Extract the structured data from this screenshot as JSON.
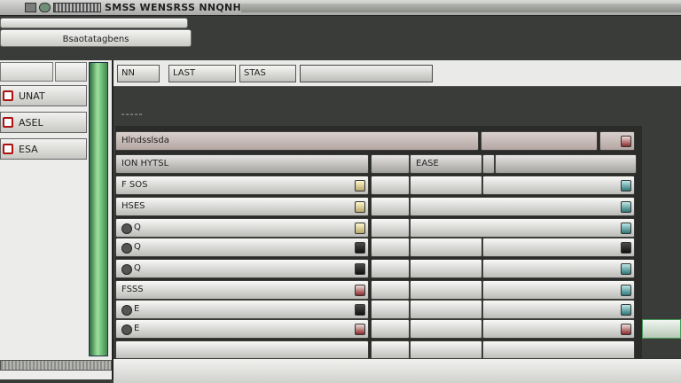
{
  "window": {
    "title": "SMSS WENSRSS NNQNHES"
  },
  "top": {
    "tab_label": "Bsaotatagbens"
  },
  "left_panel": {
    "items": [
      {
        "label": "UNAT"
      },
      {
        "label": "ASEL"
      },
      {
        "label": "ESA"
      }
    ]
  },
  "toolbar": {
    "buttons": [
      {
        "label": "NN"
      },
      {
        "label": "LAST"
      },
      {
        "label": "STAS"
      }
    ]
  },
  "grid": {
    "title": "Hlndsslsda",
    "header": {
      "col1": "ION HYTSL",
      "col3": "EASE"
    },
    "rows": [
      {
        "label": "F SOS",
        "mini": "yel",
        "right": "teal",
        "c3_label": ""
      },
      {
        "label": "HSES",
        "mini": "yel",
        "right": "teal"
      },
      {
        "label": "Q",
        "mini": "yel",
        "right": "teal"
      },
      {
        "label": "Q",
        "mini": "dark",
        "right": "dark"
      },
      {
        "label": "Q",
        "mini": "dark",
        "right": "teal"
      },
      {
        "label": "FSSS",
        "mini": "red",
        "right": "teal"
      },
      {
        "label": "E",
        "mini": "dark",
        "right": "teal"
      },
      {
        "label": "E",
        "mini": "red",
        "right": "red"
      }
    ]
  },
  "icons": {
    "title_icons": [
      "window-icon",
      "settings-icon"
    ]
  }
}
